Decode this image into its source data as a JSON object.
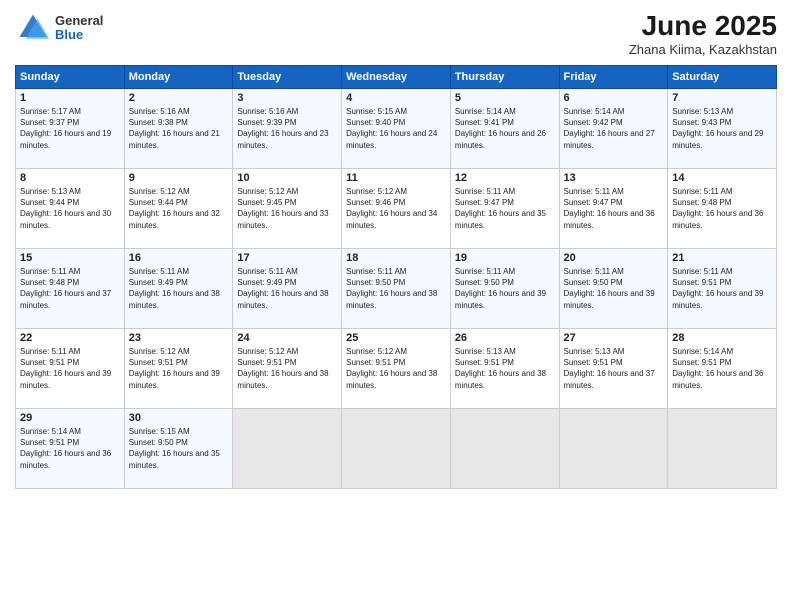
{
  "header": {
    "logo_general": "General",
    "logo_blue": "Blue",
    "month_year": "June 2025",
    "location": "Zhana Kiima, Kazakhstan"
  },
  "days_of_week": [
    "Sunday",
    "Monday",
    "Tuesday",
    "Wednesday",
    "Thursday",
    "Friday",
    "Saturday"
  ],
  "weeks": [
    [
      {
        "day": "1",
        "sunrise": "Sunrise: 5:17 AM",
        "sunset": "Sunset: 9:37 PM",
        "daylight": "Daylight: 16 hours and 19 minutes."
      },
      {
        "day": "2",
        "sunrise": "Sunrise: 5:16 AM",
        "sunset": "Sunset: 9:38 PM",
        "daylight": "Daylight: 16 hours and 21 minutes."
      },
      {
        "day": "3",
        "sunrise": "Sunrise: 5:16 AM",
        "sunset": "Sunset: 9:39 PM",
        "daylight": "Daylight: 16 hours and 23 minutes."
      },
      {
        "day": "4",
        "sunrise": "Sunrise: 5:15 AM",
        "sunset": "Sunset: 9:40 PM",
        "daylight": "Daylight: 16 hours and 24 minutes."
      },
      {
        "day": "5",
        "sunrise": "Sunrise: 5:14 AM",
        "sunset": "Sunset: 9:41 PM",
        "daylight": "Daylight: 16 hours and 26 minutes."
      },
      {
        "day": "6",
        "sunrise": "Sunrise: 5:14 AM",
        "sunset": "Sunset: 9:42 PM",
        "daylight": "Daylight: 16 hours and 27 minutes."
      },
      {
        "day": "7",
        "sunrise": "Sunrise: 5:13 AM",
        "sunset": "Sunset: 9:43 PM",
        "daylight": "Daylight: 16 hours and 29 minutes."
      }
    ],
    [
      {
        "day": "8",
        "sunrise": "Sunrise: 5:13 AM",
        "sunset": "Sunset: 9:44 PM",
        "daylight": "Daylight: 16 hours and 30 minutes."
      },
      {
        "day": "9",
        "sunrise": "Sunrise: 5:12 AM",
        "sunset": "Sunset: 9:44 PM",
        "daylight": "Daylight: 16 hours and 32 minutes."
      },
      {
        "day": "10",
        "sunrise": "Sunrise: 5:12 AM",
        "sunset": "Sunset: 9:45 PM",
        "daylight": "Daylight: 16 hours and 33 minutes."
      },
      {
        "day": "11",
        "sunrise": "Sunrise: 5:12 AM",
        "sunset": "Sunset: 9:46 PM",
        "daylight": "Daylight: 16 hours and 34 minutes."
      },
      {
        "day": "12",
        "sunrise": "Sunrise: 5:11 AM",
        "sunset": "Sunset: 9:47 PM",
        "daylight": "Daylight: 16 hours and 35 minutes."
      },
      {
        "day": "13",
        "sunrise": "Sunrise: 5:11 AM",
        "sunset": "Sunset: 9:47 PM",
        "daylight": "Daylight: 16 hours and 36 minutes."
      },
      {
        "day": "14",
        "sunrise": "Sunrise: 5:11 AM",
        "sunset": "Sunset: 9:48 PM",
        "daylight": "Daylight: 16 hours and 36 minutes."
      }
    ],
    [
      {
        "day": "15",
        "sunrise": "Sunrise: 5:11 AM",
        "sunset": "Sunset: 9:48 PM",
        "daylight": "Daylight: 16 hours and 37 minutes."
      },
      {
        "day": "16",
        "sunrise": "Sunrise: 5:11 AM",
        "sunset": "Sunset: 9:49 PM",
        "daylight": "Daylight: 16 hours and 38 minutes."
      },
      {
        "day": "17",
        "sunrise": "Sunrise: 5:11 AM",
        "sunset": "Sunset: 9:49 PM",
        "daylight": "Daylight: 16 hours and 38 minutes."
      },
      {
        "day": "18",
        "sunrise": "Sunrise: 5:11 AM",
        "sunset": "Sunset: 9:50 PM",
        "daylight": "Daylight: 16 hours and 38 minutes."
      },
      {
        "day": "19",
        "sunrise": "Sunrise: 5:11 AM",
        "sunset": "Sunset: 9:50 PM",
        "daylight": "Daylight: 16 hours and 39 minutes."
      },
      {
        "day": "20",
        "sunrise": "Sunrise: 5:11 AM",
        "sunset": "Sunset: 9:50 PM",
        "daylight": "Daylight: 16 hours and 39 minutes."
      },
      {
        "day": "21",
        "sunrise": "Sunrise: 5:11 AM",
        "sunset": "Sunset: 9:51 PM",
        "daylight": "Daylight: 16 hours and 39 minutes."
      }
    ],
    [
      {
        "day": "22",
        "sunrise": "Sunrise: 5:11 AM",
        "sunset": "Sunset: 9:51 PM",
        "daylight": "Daylight: 16 hours and 39 minutes."
      },
      {
        "day": "23",
        "sunrise": "Sunrise: 5:12 AM",
        "sunset": "Sunset: 9:51 PM",
        "daylight": "Daylight: 16 hours and 39 minutes."
      },
      {
        "day": "24",
        "sunrise": "Sunrise: 5:12 AM",
        "sunset": "Sunset: 9:51 PM",
        "daylight": "Daylight: 16 hours and 38 minutes."
      },
      {
        "day": "25",
        "sunrise": "Sunrise: 5:12 AM",
        "sunset": "Sunset: 9:51 PM",
        "daylight": "Daylight: 16 hours and 38 minutes."
      },
      {
        "day": "26",
        "sunrise": "Sunrise: 5:13 AM",
        "sunset": "Sunset: 9:51 PM",
        "daylight": "Daylight: 16 hours and 38 minutes."
      },
      {
        "day": "27",
        "sunrise": "Sunrise: 5:13 AM",
        "sunset": "Sunset: 9:51 PM",
        "daylight": "Daylight: 16 hours and 37 minutes."
      },
      {
        "day": "28",
        "sunrise": "Sunrise: 5:14 AM",
        "sunset": "Sunset: 9:51 PM",
        "daylight": "Daylight: 16 hours and 36 minutes."
      }
    ],
    [
      {
        "day": "29",
        "sunrise": "Sunrise: 5:14 AM",
        "sunset": "Sunset: 9:51 PM",
        "daylight": "Daylight: 16 hours and 36 minutes."
      },
      {
        "day": "30",
        "sunrise": "Sunrise: 5:15 AM",
        "sunset": "Sunset: 9:50 PM",
        "daylight": "Daylight: 16 hours and 35 minutes."
      },
      null,
      null,
      null,
      null,
      null
    ]
  ]
}
